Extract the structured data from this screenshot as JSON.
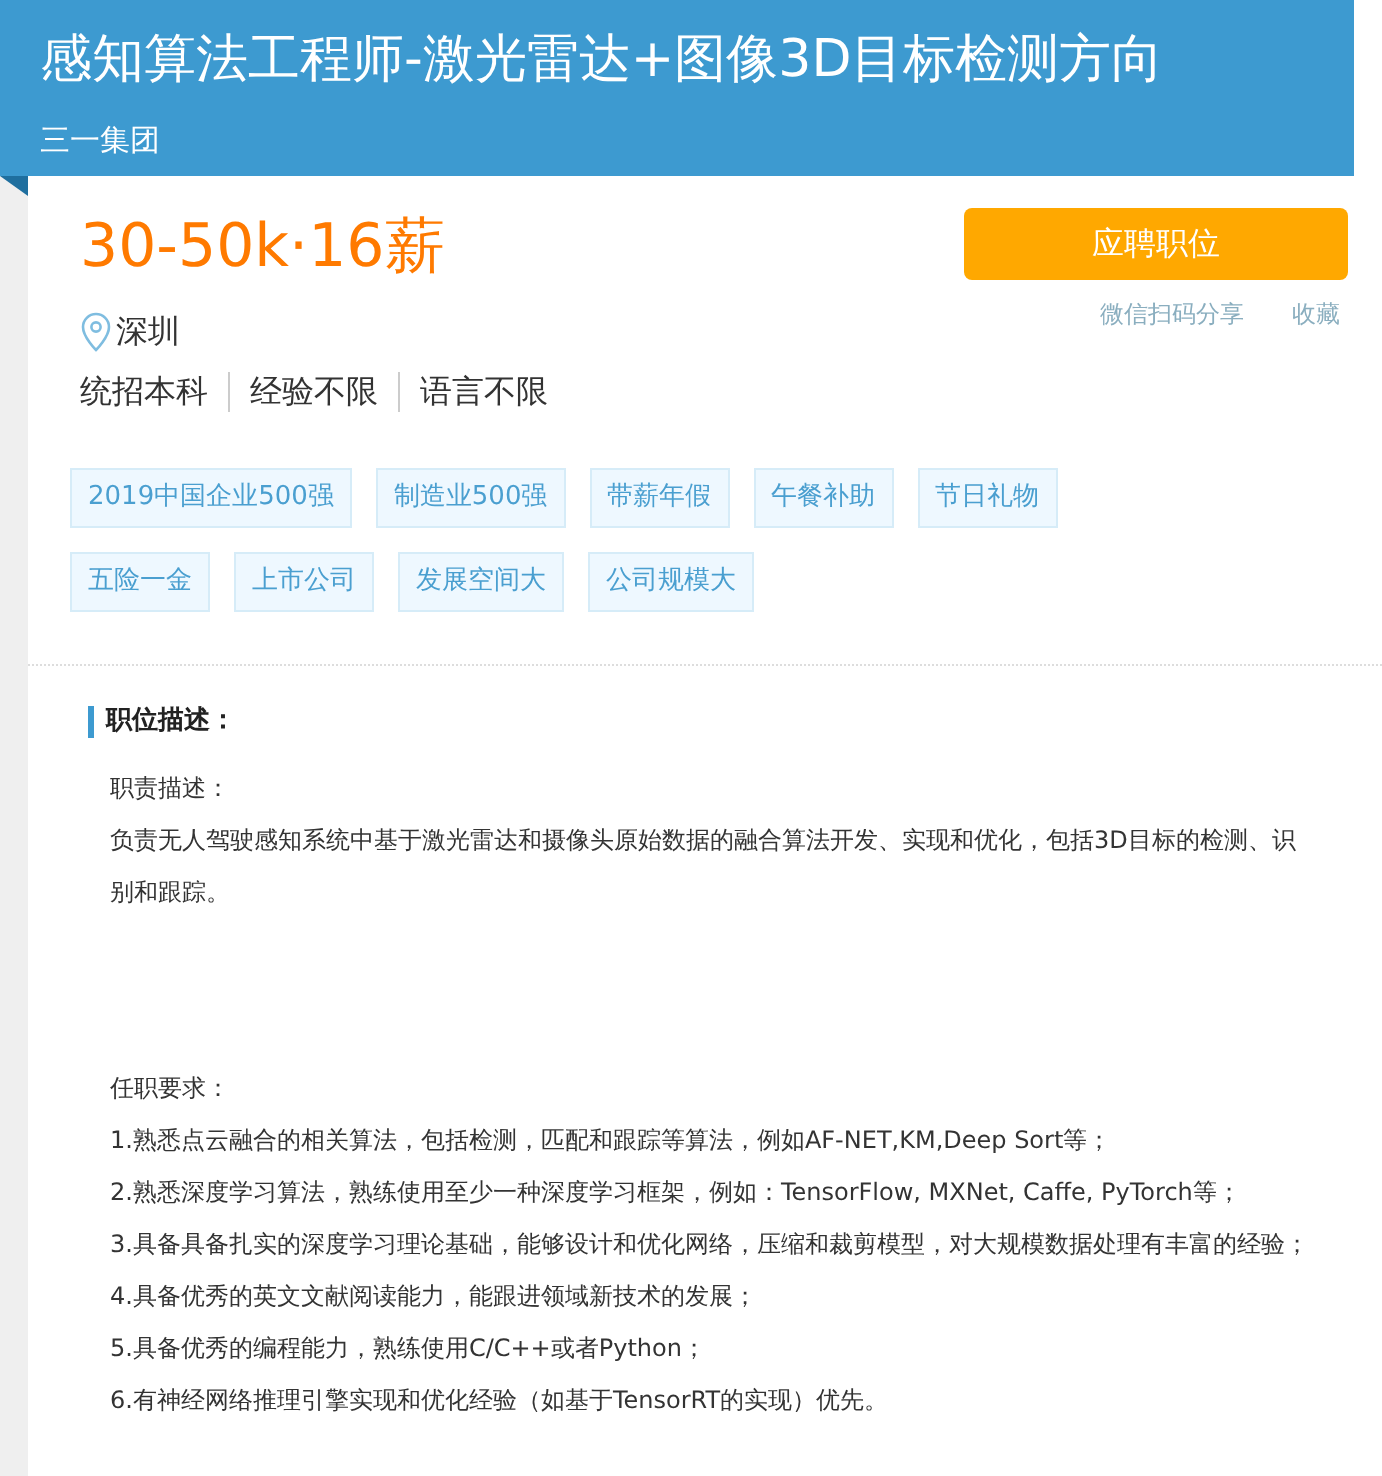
{
  "header": {
    "title": "感知算法工程师-激光雷达+图像3D目标检测方向",
    "company": "三一集团"
  },
  "salary": "30-50k·16薪",
  "apply_button": "应聘职位",
  "links": [
    "微信扫码分享",
    "收藏"
  ],
  "location": "深圳",
  "requirements": [
    "统招本科",
    "经验不限",
    "语言不限"
  ],
  "tags": [
    [
      "2019中国企业500强",
      "制造业500强",
      "带薪年假",
      "午餐补助",
      "节日礼物"
    ],
    [
      "五险一金",
      "上市公司",
      "发展空间大",
      "公司规模大"
    ]
  ],
  "section_title": "职位描述：",
  "description": [
    {
      "heading": "职责描述：",
      "lines": [
        "负责无人驾驶感知系统中基于激光雷达和摄像头原始数据的融合算法开发、实现和优化，包括3D目标的检测、识别和跟踪。"
      ]
    },
    {
      "heading": "任职要求：",
      "lines": [
        "1.熟悉点云融合的相关算法，包括检测，匹配和跟踪等算法，例如AF-NET,KM,Deep Sort等；",
        "2.熟悉深度学习算法，熟练使用至少一种深度学习框架，例如：TensorFlow, MXNet, Caffe, PyTorch等；",
        "3.具备具备扎实的深度学习理论基础，能够设计和优化网络，压缩和裁剪模型，对大规模数据处理有丰富的经验；",
        "4.具备优秀的英文文献阅读能力，能跟进领域新技术的发展；",
        "5.具备优秀的编程能力，熟练使用C/C++或者Python；",
        "6.有神经网络推理引擎实现和优化经验（如基于TensorRT的实现）优先。"
      ]
    }
  ]
}
